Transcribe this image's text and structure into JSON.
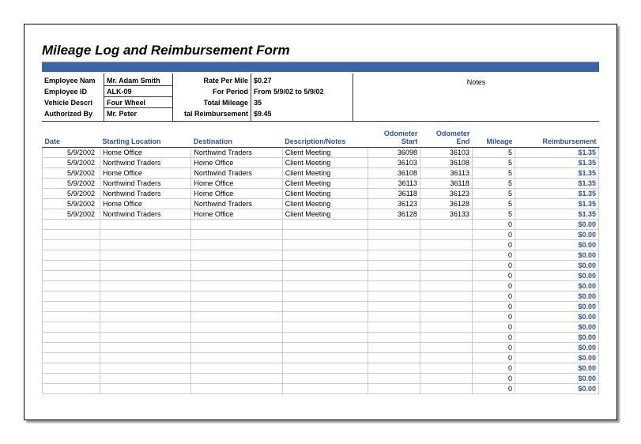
{
  "title": "Mileage Log and Reimbursement Form",
  "header": {
    "labels1": {
      "employee_name": "Employee Nam",
      "employee_id": "Employee ID",
      "vehicle_desc": "Vehicle Descri",
      "authorized_by": "Authorized By"
    },
    "values1": {
      "employee_name": "Mr. Adam Smith",
      "employee_id": "ALK-09",
      "vehicle_desc": "Four Wheel",
      "authorized_by": "Mr. Peter"
    },
    "labels2": {
      "rate": "Rate Per Mile",
      "period": "For Period",
      "total_mileage": "Total Mileage",
      "total_reimb": "tal Reimbursement"
    },
    "values2": {
      "rate": "$0.27",
      "period": "From 5/9/02 to 5/9/02",
      "total_mileage": "35",
      "total_reimb": "$9.45"
    },
    "notes_label": "Notes"
  },
  "columns": {
    "date": "Date",
    "start": "Starting Location",
    "dest": "Destination",
    "desc": "Description/Notes",
    "odo_start": "Odometer Start",
    "odo_end": "Odometer End",
    "mileage": "Mileage",
    "reimb": "Reimbursement"
  },
  "rows": [
    {
      "date": "5/9/2002",
      "start": "Home Office",
      "dest": "Northwind Traders",
      "desc": "Client Meeting",
      "odo_start": "36098",
      "odo_end": "36103",
      "mileage": "5",
      "reimb": "$1.35"
    },
    {
      "date": "5/9/2002",
      "start": "Northwind Traders",
      "dest": "Home Office",
      "desc": "Client Meeting",
      "odo_start": "36103",
      "odo_end": "36108",
      "mileage": "5",
      "reimb": "$1.35"
    },
    {
      "date": "5/9/2002",
      "start": "Home Office",
      "dest": "Northwind Traders",
      "desc": "Client Meeting",
      "odo_start": "36108",
      "odo_end": "36113",
      "mileage": "5",
      "reimb": "$1.35"
    },
    {
      "date": "5/9/2002",
      "start": "Northwind Traders",
      "dest": "Home Office",
      "desc": "Client Meeting",
      "odo_start": "36113",
      "odo_end": "36118",
      "mileage": "5",
      "reimb": "$1.35"
    },
    {
      "date": "5/9/2002",
      "start": "Northwind Traders",
      "dest": "Home Office",
      "desc": "Client Meeting",
      "odo_start": "36118",
      "odo_end": "36123",
      "mileage": "5",
      "reimb": "$1.35"
    },
    {
      "date": "5/9/2002",
      "start": "Home Office",
      "dest": "Northwind Traders",
      "desc": "Client Meeting",
      "odo_start": "36123",
      "odo_end": "36128",
      "mileage": "5",
      "reimb": "$1.35"
    },
    {
      "date": "5/9/2002",
      "start": "Northwind Traders",
      "dest": "Home Office",
      "desc": "Client Meeting",
      "odo_start": "36128",
      "odo_end": "36133",
      "mileage": "5",
      "reimb": "$1.35"
    },
    {
      "date": "",
      "start": "",
      "dest": "",
      "desc": "",
      "odo_start": "",
      "odo_end": "",
      "mileage": "0",
      "reimb": "$0.00"
    },
    {
      "date": "",
      "start": "",
      "dest": "",
      "desc": "",
      "odo_start": "",
      "odo_end": "",
      "mileage": "0",
      "reimb": "$0.00"
    },
    {
      "date": "",
      "start": "",
      "dest": "",
      "desc": "",
      "odo_start": "",
      "odo_end": "",
      "mileage": "0",
      "reimb": "$0.00"
    },
    {
      "date": "",
      "start": "",
      "dest": "",
      "desc": "",
      "odo_start": "",
      "odo_end": "",
      "mileage": "0",
      "reimb": "$0.00"
    },
    {
      "date": "",
      "start": "",
      "dest": "",
      "desc": "",
      "odo_start": "",
      "odo_end": "",
      "mileage": "0",
      "reimb": "$0.00"
    },
    {
      "date": "",
      "start": "",
      "dest": "",
      "desc": "",
      "odo_start": "",
      "odo_end": "",
      "mileage": "0",
      "reimb": "$0.00"
    },
    {
      "date": "",
      "start": "",
      "dest": "",
      "desc": "",
      "odo_start": "",
      "odo_end": "",
      "mileage": "0",
      "reimb": "$0.00"
    },
    {
      "date": "",
      "start": "",
      "dest": "",
      "desc": "",
      "odo_start": "",
      "odo_end": "",
      "mileage": "0",
      "reimb": "$0.00"
    },
    {
      "date": "",
      "start": "",
      "dest": "",
      "desc": "",
      "odo_start": "",
      "odo_end": "",
      "mileage": "0",
      "reimb": "$0.00"
    },
    {
      "date": "",
      "start": "",
      "dest": "",
      "desc": "",
      "odo_start": "",
      "odo_end": "",
      "mileage": "0",
      "reimb": "$0.00"
    },
    {
      "date": "",
      "start": "",
      "dest": "",
      "desc": "",
      "odo_start": "",
      "odo_end": "",
      "mileage": "0",
      "reimb": "$0.00"
    },
    {
      "date": "",
      "start": "",
      "dest": "",
      "desc": "",
      "odo_start": "",
      "odo_end": "",
      "mileage": "0",
      "reimb": "$0.00"
    },
    {
      "date": "",
      "start": "",
      "dest": "",
      "desc": "",
      "odo_start": "",
      "odo_end": "",
      "mileage": "0",
      "reimb": "$0.00"
    },
    {
      "date": "",
      "start": "",
      "dest": "",
      "desc": "",
      "odo_start": "",
      "odo_end": "",
      "mileage": "0",
      "reimb": "$0.00"
    },
    {
      "date": "",
      "start": "",
      "dest": "",
      "desc": "",
      "odo_start": "",
      "odo_end": "",
      "mileage": "0",
      "reimb": "$0.00"
    },
    {
      "date": "",
      "start": "",
      "dest": "",
      "desc": "",
      "odo_start": "",
      "odo_end": "",
      "mileage": "0",
      "reimb": "$0.00"
    },
    {
      "date": "",
      "start": "",
      "dest": "",
      "desc": "",
      "odo_start": "",
      "odo_end": "",
      "mileage": "0",
      "reimb": "$0.00"
    }
  ]
}
